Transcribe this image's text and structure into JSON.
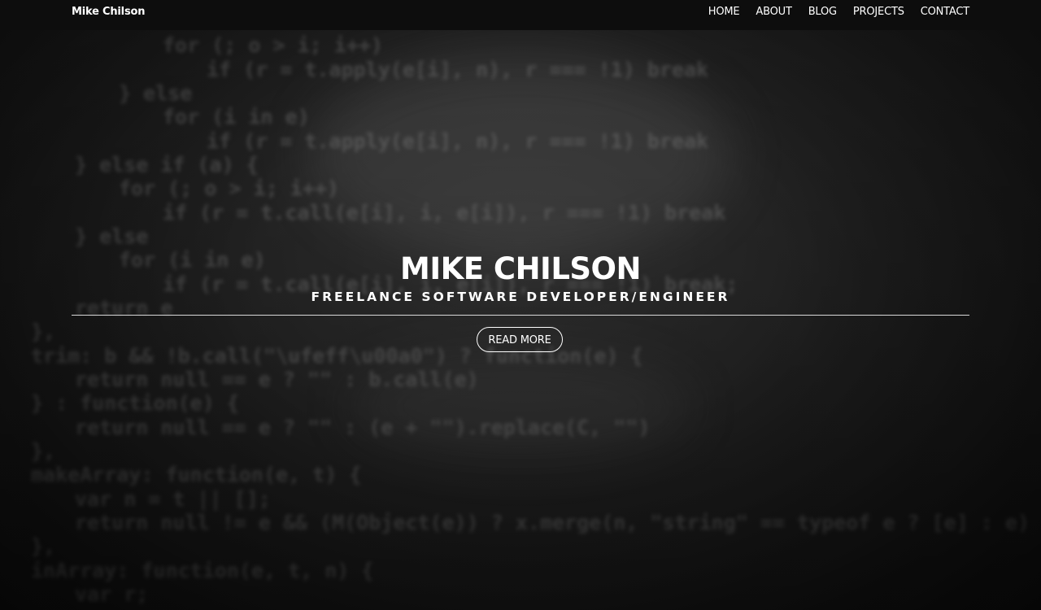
{
  "navbar": {
    "brand": "Mike Chilson",
    "links": [
      {
        "label": "HOME"
      },
      {
        "label": "ABOUT"
      },
      {
        "label": "BLOG"
      },
      {
        "label": "PROJECTS"
      },
      {
        "label": "CONTACT"
      }
    ]
  },
  "hero": {
    "title": "MIKE CHILSON",
    "subtitle": "FREELANCE SOFTWARE DEVELOPER/ENGINEER",
    "button_label": "READ MORE"
  },
  "background_code": [
    "for (; o > i; i++)",
    "if (r = t.apply(e[i], n), r === !1) break",
    "} else",
    "for (i in e)",
    "if (r = t.apply(e[i], n), r === !1) break",
    "} else if (a) {",
    "for (; o > i; i++)",
    "if (r = t.call(e[i], i, e[i]), r === !1) break",
    "} else",
    "for (i in e)",
    "if (r = t.call(e[i], i, e[i]), r === !1) break;",
    "return e",
    "},",
    "trim: b && !b.call(\"\\ufeff\\u00a0\") ? function(e) {",
    "return null == e ? \"\" : b.call(e)",
    "} : function(e) {",
    "return null == e ? \"\" : (e + \"\").replace(C, \"\")",
    "},",
    "makeArray: function(e, t) {",
    "var n = t || [];",
    "return null != e && (M(Object(e)) ? x.merge(n, \"string\" == typeof e ? [e] : e) : h.call(n, e)), n",
    "},",
    "inArray: function(e, t, n) {",
    "var r;"
  ],
  "colors": {
    "navbar_bg": "#0d0d0d",
    "text": "#ffffff",
    "divider": "#d8d8d8"
  }
}
